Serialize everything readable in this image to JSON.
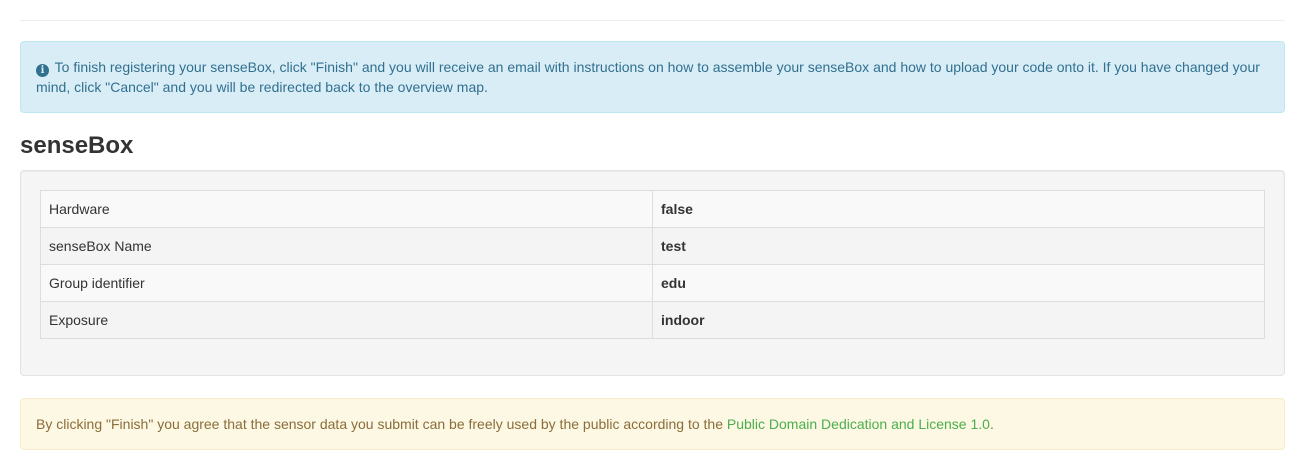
{
  "info_alert": {
    "icon": "info-circle-icon",
    "text": "To finish registering your senseBox, click \"Finish\" and you will receive an email with instructions on how to assemble your senseBox and how to upload your code onto it. If you have changed your mind, click \"Cancel\" and you will be redirected back to the overview map."
  },
  "section": {
    "title": "senseBox"
  },
  "summary": {
    "rows": [
      {
        "label": "Hardware",
        "value": "false"
      },
      {
        "label": "senseBox Name",
        "value": "test"
      },
      {
        "label": "Group identifier",
        "value": "edu"
      },
      {
        "label": "Exposure",
        "value": "indoor"
      }
    ]
  },
  "license_notice": {
    "text_before": "By clicking \"Finish\" you agree that the sensor data you submit can be freely used by the public according to the ",
    "link_text": "Public Domain Dedication and License 1.0",
    "text_after": "."
  },
  "colors": {
    "info_background": "#d9edf7",
    "info_text": "#31708f",
    "warning_background": "#fcf8e3",
    "warning_text": "#8a6d3b",
    "link": "#4cae4c"
  }
}
